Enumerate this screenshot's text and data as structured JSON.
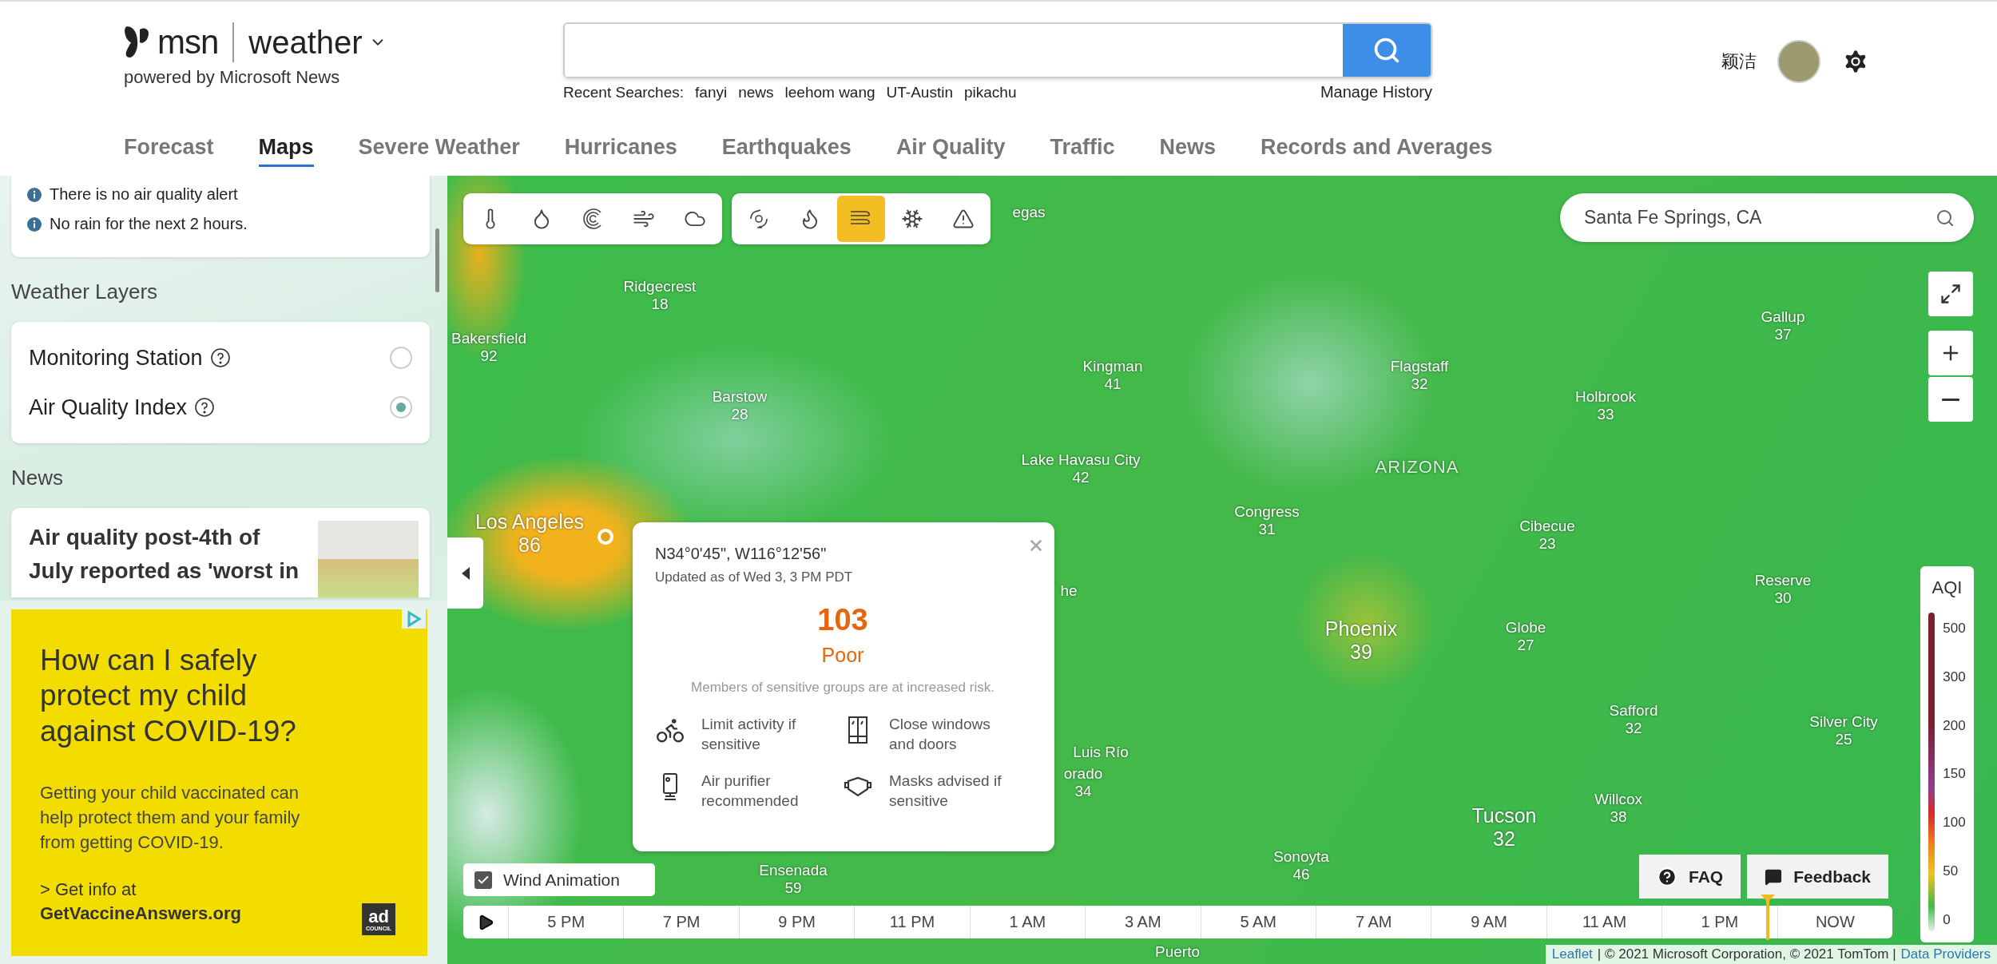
{
  "header": {
    "brand": "msn",
    "product": "weather",
    "tagline": "powered by Microsoft News",
    "recent_label": "Recent Searches:",
    "recent": [
      "fanyi",
      "news",
      "leehom wang",
      "UT-Austin",
      "pikachu"
    ],
    "manage": "Manage History",
    "user": "颖洁"
  },
  "nav": [
    {
      "label": "Forecast",
      "selected": false
    },
    {
      "label": "Maps",
      "selected": true
    },
    {
      "label": "Severe Weather",
      "selected": false
    },
    {
      "label": "Hurricanes",
      "selected": false
    },
    {
      "label": "Earthquakes",
      "selected": false
    },
    {
      "label": "Air Quality",
      "selected": false
    },
    {
      "label": "Traffic",
      "selected": false
    },
    {
      "label": "News",
      "selected": false
    },
    {
      "label": "Records and Averages",
      "selected": false
    }
  ],
  "sidebar": {
    "alerts": [
      "There is no air quality alert",
      "No rain for the next 2 hours."
    ],
    "layers_title": "Weather Layers",
    "layers": [
      {
        "label": "Monitoring Station",
        "selected": false
      },
      {
        "label": "Air Quality Index",
        "selected": true
      }
    ],
    "news_title": "News",
    "news": [
      {
        "title": "Air quality post-4th of July reported as 'worst in"
      }
    ]
  },
  "ad": {
    "headline": "How can I safely protect my child against COVID-19?",
    "body": "Getting your child vaccinated can help protect them and your family from getting COVID-19.",
    "cta": "> Get info at",
    "link": "GetVaccineAnswers.org",
    "logo_top": "ad",
    "logo_bottom": "COUNCIL"
  },
  "map": {
    "layer_groups": [
      [
        {
          "kind": "temperature",
          "selected": false
        },
        {
          "kind": "precipitation",
          "selected": false
        },
        {
          "kind": "radar",
          "selected": false
        },
        {
          "kind": "wind",
          "selected": false
        },
        {
          "kind": "cloud",
          "selected": false
        }
      ],
      [
        {
          "kind": "hurricane",
          "selected": false
        },
        {
          "kind": "fire",
          "selected": false
        },
        {
          "kind": "air",
          "selected": true
        },
        {
          "kind": "snow",
          "selected": false
        },
        {
          "kind": "alert",
          "selected": false
        }
      ]
    ],
    "search": {
      "value": "Santa Fe Springs, CA"
    },
    "labels": [
      {
        "name": "egas",
        "kind": "city"
      },
      {
        "name": "Ridgecrest",
        "value": "18",
        "kind": "city"
      },
      {
        "name": "Bakersfield",
        "value": "92",
        "kind": "city"
      },
      {
        "name": "Barstow",
        "value": "28",
        "kind": "city"
      },
      {
        "name": "Kingman",
        "value": "41",
        "kind": "city"
      },
      {
        "name": "Lake Havasu City",
        "value": "42",
        "kind": "city"
      },
      {
        "name": "Flagstaff",
        "value": "32",
        "kind": "city"
      },
      {
        "name": "Holbrook",
        "value": "33",
        "kind": "city"
      },
      {
        "name": "Gallup",
        "value": "37",
        "kind": "city"
      },
      {
        "name": "ARIZONA",
        "kind": "region"
      },
      {
        "name": "Los Angeles",
        "value": "86",
        "kind": "major"
      },
      {
        "name": "Congress",
        "value": "31",
        "kind": "city"
      },
      {
        "name": "Cibecue",
        "value": "23",
        "kind": "city"
      },
      {
        "name": "Reserve",
        "value": "30",
        "kind": "city"
      },
      {
        "name": "Phoenix",
        "value": "39",
        "kind": "major"
      },
      {
        "name": "Globe",
        "value": "27",
        "kind": "city"
      },
      {
        "name": "Safford",
        "value": "32",
        "kind": "city"
      },
      {
        "name": "Silver City",
        "value": "25",
        "kind": "city"
      },
      {
        "name": "he",
        "kind": "city"
      },
      {
        "name": "Luis Río",
        "kind": "city"
      },
      {
        "name": "orado",
        "value": "34",
        "kind": "city"
      },
      {
        "name": "Willcox",
        "value": "38",
        "kind": "city"
      },
      {
        "name": "Tucson",
        "value": "32",
        "kind": "major"
      },
      {
        "name": "Sonoyta",
        "value": "46",
        "kind": "city"
      },
      {
        "name": "Ensenada",
        "value": "59",
        "kind": "city"
      },
      {
        "name": "Puerto",
        "kind": "city"
      }
    ],
    "popup": {
      "coords": "N34°0'45\", W116°12'56\"",
      "updated": "Updated as of Wed 3, 3 PM PDT",
      "aqi": "103",
      "category": "Poor",
      "risk": "Members of sensitive groups are at increased risk.",
      "advice": [
        {
          "kind": "bike",
          "text": "Limit activity if sensitive"
        },
        {
          "kind": "window",
          "text": "Close windows and doors"
        },
        {
          "kind": "purifier",
          "text": "Air purifier recommended"
        },
        {
          "kind": "mask",
          "text": "Masks advised if sensitive"
        }
      ]
    },
    "wind_animation": {
      "label": "Wind Animation",
      "checked": true
    },
    "buttons": [
      {
        "kind": "faq",
        "label": "FAQ"
      },
      {
        "kind": "feedback",
        "label": "Feedback"
      }
    ],
    "timeline": {
      "times": [
        "5 PM",
        "7 PM",
        "9 PM",
        "11 PM",
        "1 AM",
        "3 AM",
        "5 AM",
        "7 AM",
        "9 AM",
        "11 AM",
        "1 PM",
        "NOW"
      ],
      "level": 0.91
    },
    "legend": {
      "title": "AQI",
      "ticks": [
        "500",
        "300",
        "200",
        "150",
        "100",
        "50",
        "0"
      ]
    },
    "attribution": {
      "link": "Leaflet",
      "text": "| © 2021 Microsoft Corporation, © 2021 TomTom |",
      "providers": "Data Providers"
    }
  }
}
